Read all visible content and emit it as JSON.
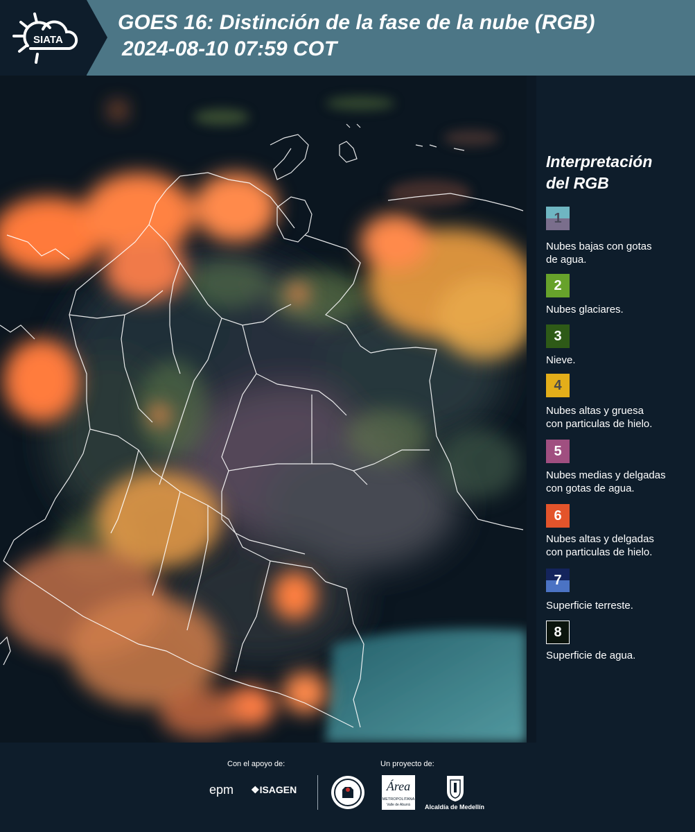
{
  "header": {
    "logo_text": "SIATA",
    "title_line1": "GOES 16: Distinción de la fase de la nube (RGB)",
    "title_line2": "2024-08-10 07:59 COT"
  },
  "legend": {
    "title_line1": "Interpretación",
    "title_line2": "del RGB",
    "items": [
      {
        "number": "1",
        "color_top": "#6fb6c2",
        "color_bottom": "#7a6e8c",
        "number_color": "#4a4a5a",
        "line1": "Nubes bajas con gotas",
        "line2": "de agua."
      },
      {
        "number": "2",
        "color": "#67a22b",
        "number_color": "#ffffff",
        "line1": "Nubes glaciares.",
        "line2": ""
      },
      {
        "number": "3",
        "color": "#2e5a17",
        "number_color": "#ffffff",
        "line1": "Nieve.",
        "line2": ""
      },
      {
        "number": "4",
        "color": "#e3ae1a",
        "number_color": "#4a4a4a",
        "line1": "Nubes altas y gruesa",
        "line2": "con particulas de hielo."
      },
      {
        "number": "5",
        "color": "#a04f80",
        "number_color": "#ffffff",
        "line1": "Nubes medias y delgadas",
        "line2": "con gotas de agua."
      },
      {
        "number": "6",
        "color": "#e3542b",
        "number_color": "#ffffff",
        "line1": "Nubes altas y delgadas",
        "line2": "con particulas de hielo."
      },
      {
        "number": "7",
        "color_top": "#14245c",
        "color_bottom": "#4b73c4",
        "number_color": "#ffffff",
        "line1": "Superficie terreste.",
        "line2": ""
      },
      {
        "number": "8",
        "color": "#0b140d",
        "number_color": "#ffffff",
        "line1": "Superficie de agua.",
        "line2": ""
      }
    ]
  },
  "footer": {
    "support_label": "Con el apoyo de:",
    "project_label": "Un proyecto de:",
    "epm_logo": "epm",
    "isagen_logo": "ISAGEN",
    "area_logo": "Área",
    "area_sub": "METROPOLITANA",
    "area_sub2": "Valle de Aburrá",
    "alcaldia": "Alcaldía de Medellín"
  }
}
